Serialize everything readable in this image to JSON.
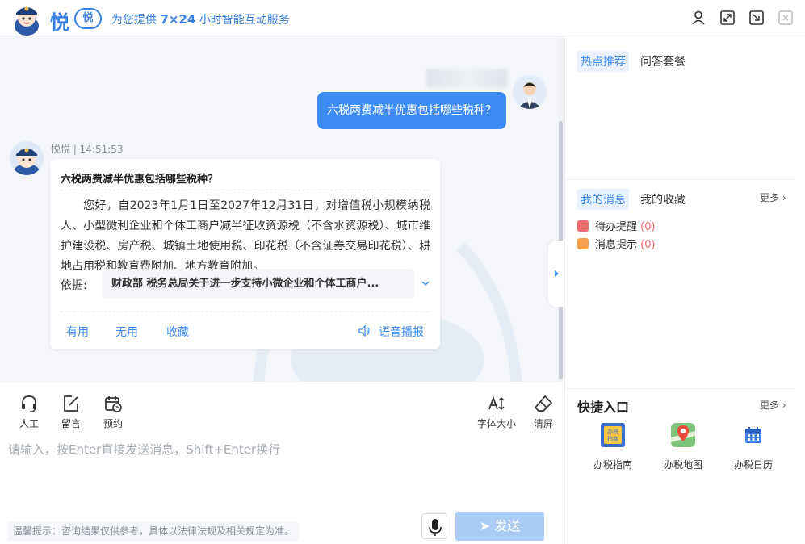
{
  "header": {
    "logo_text": "悦",
    "logo_badge": "悦",
    "slogan_prefix": "为您提供 ",
    "slogan_bold": "7×24",
    "slogan_suffix": " 小时智能互动服务",
    "icons": [
      "user-icon",
      "expand-icon",
      "exit-icon",
      "close-icon"
    ]
  },
  "chat": {
    "user_message": "六税两费减半优惠包括哪些税种？",
    "bot_meta": "悦悦 | 14:51:53",
    "answer_title": "六税两费减半优惠包括哪些税种？",
    "answer_body": "您好，自2023年1月1日至2027年12月31日，对增值税小规模纳税人、小型微利企业和个体工商户减半征收资源税（不含水资源税）、城市维护建设税、房产税、城镇土地使用税、印花税（不含证券交易印花税）、耕地占用税和教育费附加、地方教育附加。",
    "basis_label": "依据:",
    "basis_text": "财政部 税务总局关于进一步支持小微企业和个体工商户...",
    "actions": {
      "useful": "有用",
      "useless": "无用",
      "favorite": "收藏",
      "voice": "语音播报"
    }
  },
  "toolbar": {
    "human": "人工",
    "message": "留言",
    "appointment": "预约",
    "font_size": "字体大小",
    "clear": "清屏"
  },
  "input": {
    "placeholder": "请输入，按Enter直接发送消息，Shift+Enter换行",
    "tip": "温馨提示：咨询结果仅供参考，具体以法律法规及相关规定为准。",
    "send_label": "发送"
  },
  "sidebar": {
    "tabs_top": {
      "hot": "热点推荐",
      "packages": "问答套餐"
    },
    "tabs_mid": {
      "messages": "我的消息",
      "favorites": "我的收藏"
    },
    "more": "更多",
    "todo_label": "待办提醒",
    "todo_count": "(0)",
    "notice_label": "消息提示",
    "notice_count": "(0)",
    "quick_title": "快捷入口",
    "quick_more": "更多",
    "quick_items": {
      "guide": "办税指南",
      "map": "办税地图",
      "calendar": "办税日历"
    }
  },
  "colors": {
    "accent": "#3d8cf5",
    "send_disabled": "#a9cbf6",
    "alert": "#f06b6b"
  }
}
